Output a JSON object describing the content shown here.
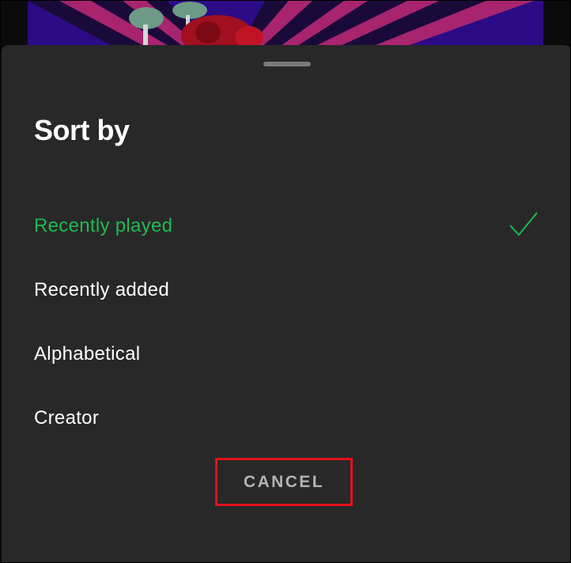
{
  "sheet": {
    "title": "Sort by",
    "options": [
      {
        "label": "Recently played",
        "selected": true
      },
      {
        "label": "Recently added",
        "selected": false
      },
      {
        "label": "Alphabetical",
        "selected": false
      },
      {
        "label": "Creator",
        "selected": false
      }
    ],
    "selected_icon": "checkmark-icon",
    "cancel_label": "CANCEL"
  },
  "colors": {
    "sheet_background": "#282828",
    "selected_text": "#1db954",
    "default_text": "#ffffff",
    "cancel_text": "#b3b3b3",
    "highlight_border": "#e3121b",
    "album_background": "#2c0b86"
  }
}
